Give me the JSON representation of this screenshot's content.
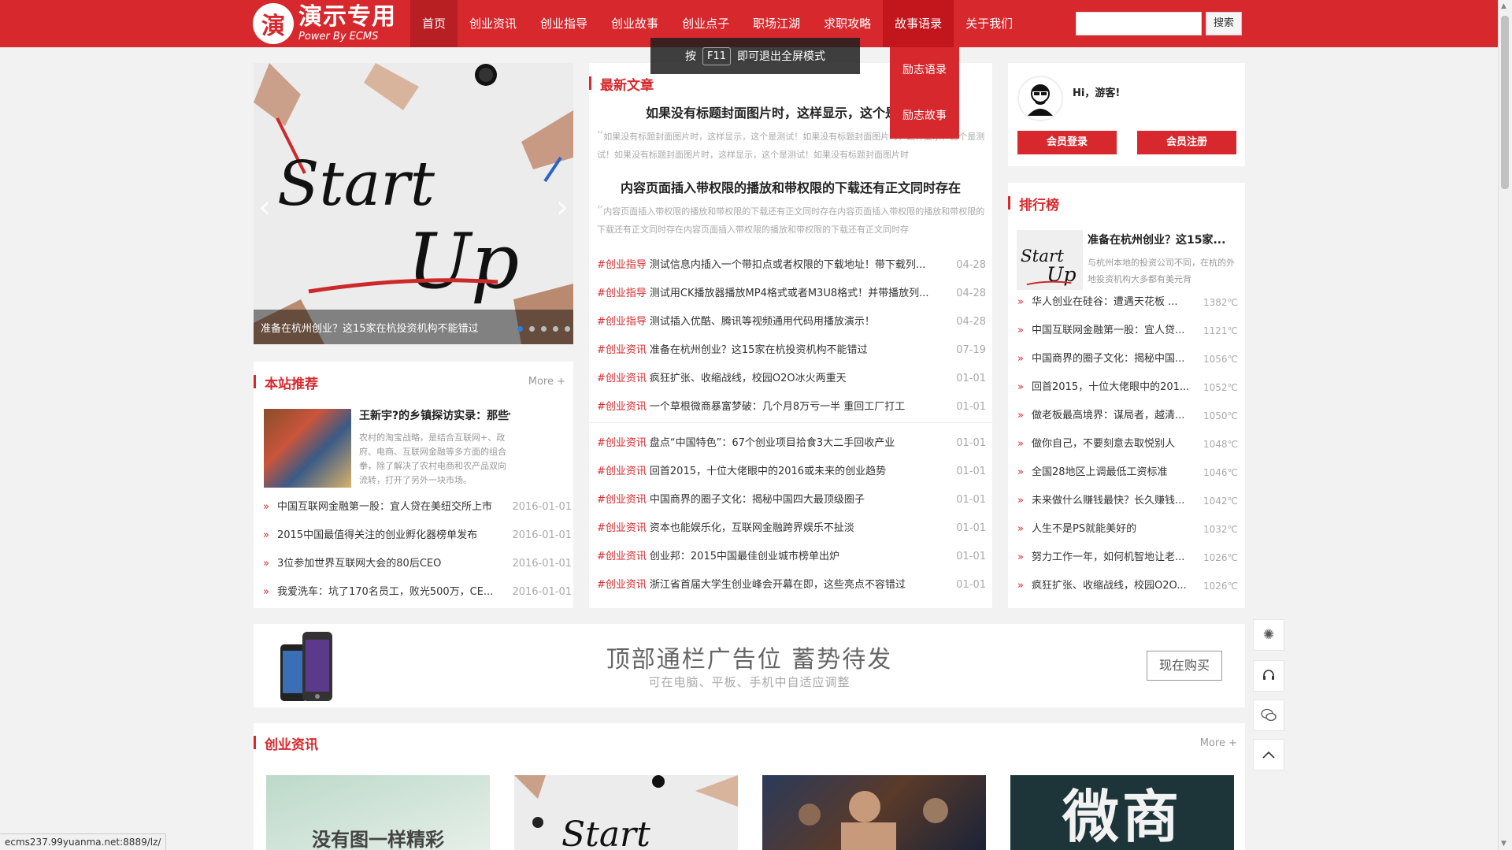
{
  "header": {
    "logo_mark": "演",
    "logo_title": "演示专用",
    "logo_sub": "Power By ECMS",
    "nav": [
      "首页",
      "创业资讯",
      "创业指导",
      "创业故事",
      "创业点子",
      "职场江湖",
      "求职攻略",
      "故事语录",
      "关于我们"
    ],
    "search_placeholder": "",
    "search_btn": "搜索"
  },
  "dropdown": [
    "励志语录",
    "励志故事"
  ],
  "f11": {
    "pre": "按",
    "key": "F11",
    "post": "即可退出全屏模式"
  },
  "slider": {
    "caption": "准备在杭州创业？这15家在杭投资机构不能错过",
    "art_words": [
      "Start",
      "Up"
    ],
    "dots": 5,
    "active_dot": 0
  },
  "recommend": {
    "title": "本站推荐",
    "more": "More +",
    "top_title": "王新宇?的乡镇探访实录：那些你不...",
    "top_desc": "农村的淘宝战略，是结合互联网+、政府、电商、互联网金融等多方面的组合拳，除了解决了农村电商和农产品双向流转，打开了另外一块市场。",
    "items": [
      {
        "t": "中国互联网金融第一股：宜人贷在美纽交所上市",
        "d": "2016-01-01"
      },
      {
        "t": "2015中国最值得关注的创业孵化器榜单发布",
        "d": "2016-01-01"
      },
      {
        "t": "3位参加世界互联网大会的80后CEO",
        "d": "2016-01-01"
      },
      {
        "t": "我爱洗车：坑了170名员工，败光500万，CE...",
        "d": "2016-01-01"
      }
    ]
  },
  "latest": {
    "title": "最新文章",
    "features": [
      {
        "t": "如果没有标题封面图片时，这样显示，这个是测试！",
        "desc": "如果没有标题封面图片时，这样显示，这个是测试！如果没有标题封面图片时，这样显示，这个是测试！如果没有标题封面图片时，这样显示，这个是测试！如果没有标题封面图片时"
      },
      {
        "t": "内容页面插入带权限的播放和带权限的下载还有正文同时存在",
        "desc": "内容页面插入带权限的播放和带权限的下载还有正文同时存在内容页面插入带权限的播放和带权限的下载还有正文同时存在内容页面插入带权限的播放和带权限的下载还有正文同时存"
      }
    ],
    "group1": [
      {
        "c": "#创业指导",
        "t": "测试信息内插入一个带扣点或者权限的下载地址！带下载列...",
        "d": "04-28"
      },
      {
        "c": "#创业指导",
        "t": "测试用CK播放器播放MP4格式或者M3U8格式！并带播放列...",
        "d": "04-28"
      },
      {
        "c": "#创业指导",
        "t": "测试插入优酷、腾讯等视频通用代码用播放演示！",
        "d": "04-28"
      },
      {
        "c": "#创业资讯",
        "t": "准备在杭州创业？这15家在杭投资机构不能错过",
        "d": "07-19"
      },
      {
        "c": "#创业资讯",
        "t": "疯狂扩张、收缩战线，校园O2O冰火两重天",
        "d": "01-01"
      },
      {
        "c": "#创业资讯",
        "t": "一个草根微商暴富梦破：几个月8万亏一半 重回工厂打工",
        "d": "01-01"
      }
    ],
    "group2": [
      {
        "c": "#创业资讯",
        "t": "盘点“中国特色”：67个创业项目拾食3大二手回收产业",
        "d": "01-01"
      },
      {
        "c": "#创业资讯",
        "t": "回首2015，十位大佬眼中的2016或未来的创业趋势",
        "d": "01-01"
      },
      {
        "c": "#创业资讯",
        "t": "中国商界的圈子文化：揭秘中国四大最顶级圈子",
        "d": "01-01"
      },
      {
        "c": "#创业资讯",
        "t": "资本也能娱乐化，互联网金融跨界娱乐不扯淡",
        "d": "01-01"
      },
      {
        "c": "#创业资讯",
        "t": "创业邦：2015中国最佳创业城市榜单出炉",
        "d": "01-01"
      },
      {
        "c": "#创业资讯",
        "t": "浙江省首届大学生创业峰会开幕在即，这些亮点不容错过",
        "d": "01-01"
      }
    ]
  },
  "user": {
    "greet": "Hi，游客!",
    "login": "会员登录",
    "register": "会员注册"
  },
  "rank": {
    "title": "排行榜",
    "top_title": "准备在杭州创业？这15家...",
    "top_desc": "与杭州本地的投资公司不同，在杭的外地投资机构大多都有美元背",
    "items": [
      {
        "t": "华人创业在硅谷：遭遇天花板 ...",
        "d": "1382℃"
      },
      {
        "t": "中国互联网金融第一股：宜人贷...",
        "d": "1121℃"
      },
      {
        "t": "中国商界的圈子文化：揭秘中国...",
        "d": "1056℃"
      },
      {
        "t": "回首2015，十位大佬眼中的201...",
        "d": "1052℃"
      },
      {
        "t": "做老板最高境界：谋局者，越清...",
        "d": "1050℃"
      },
      {
        "t": "做你自己，不要刻意去取悦别人",
        "d": "1048℃"
      },
      {
        "t": "全国28地区上调最低工资标准",
        "d": "1046℃"
      },
      {
        "t": "未来做什么赚钱最快？长久赚钱...",
        "d": "1042℃"
      },
      {
        "t": "人生不是PS就能美好的",
        "d": "1032℃"
      },
      {
        "t": "努力工作一年，如何机智地让老...",
        "d": "1026℃"
      },
      {
        "t": "疯狂扩张、收缩战线，校园O2O...",
        "d": "1026℃"
      }
    ]
  },
  "ad": {
    "main": "顶部通栏广告位 蓄势待发",
    "sub": "可在电脑、平板、手机中自适应调整",
    "btn": "现在购买"
  },
  "chuangye": {
    "title": "创业资讯",
    "more": "More +",
    "thumb1_text": "没有图一样精彩",
    "thumb2_words": "Start",
    "thumb4_text": "微商"
  },
  "status_url": "ecms237.99yuanma.net:8889/lz/",
  "colors": {
    "brand": "#d7282d",
    "active_nav": "#b71f23"
  }
}
